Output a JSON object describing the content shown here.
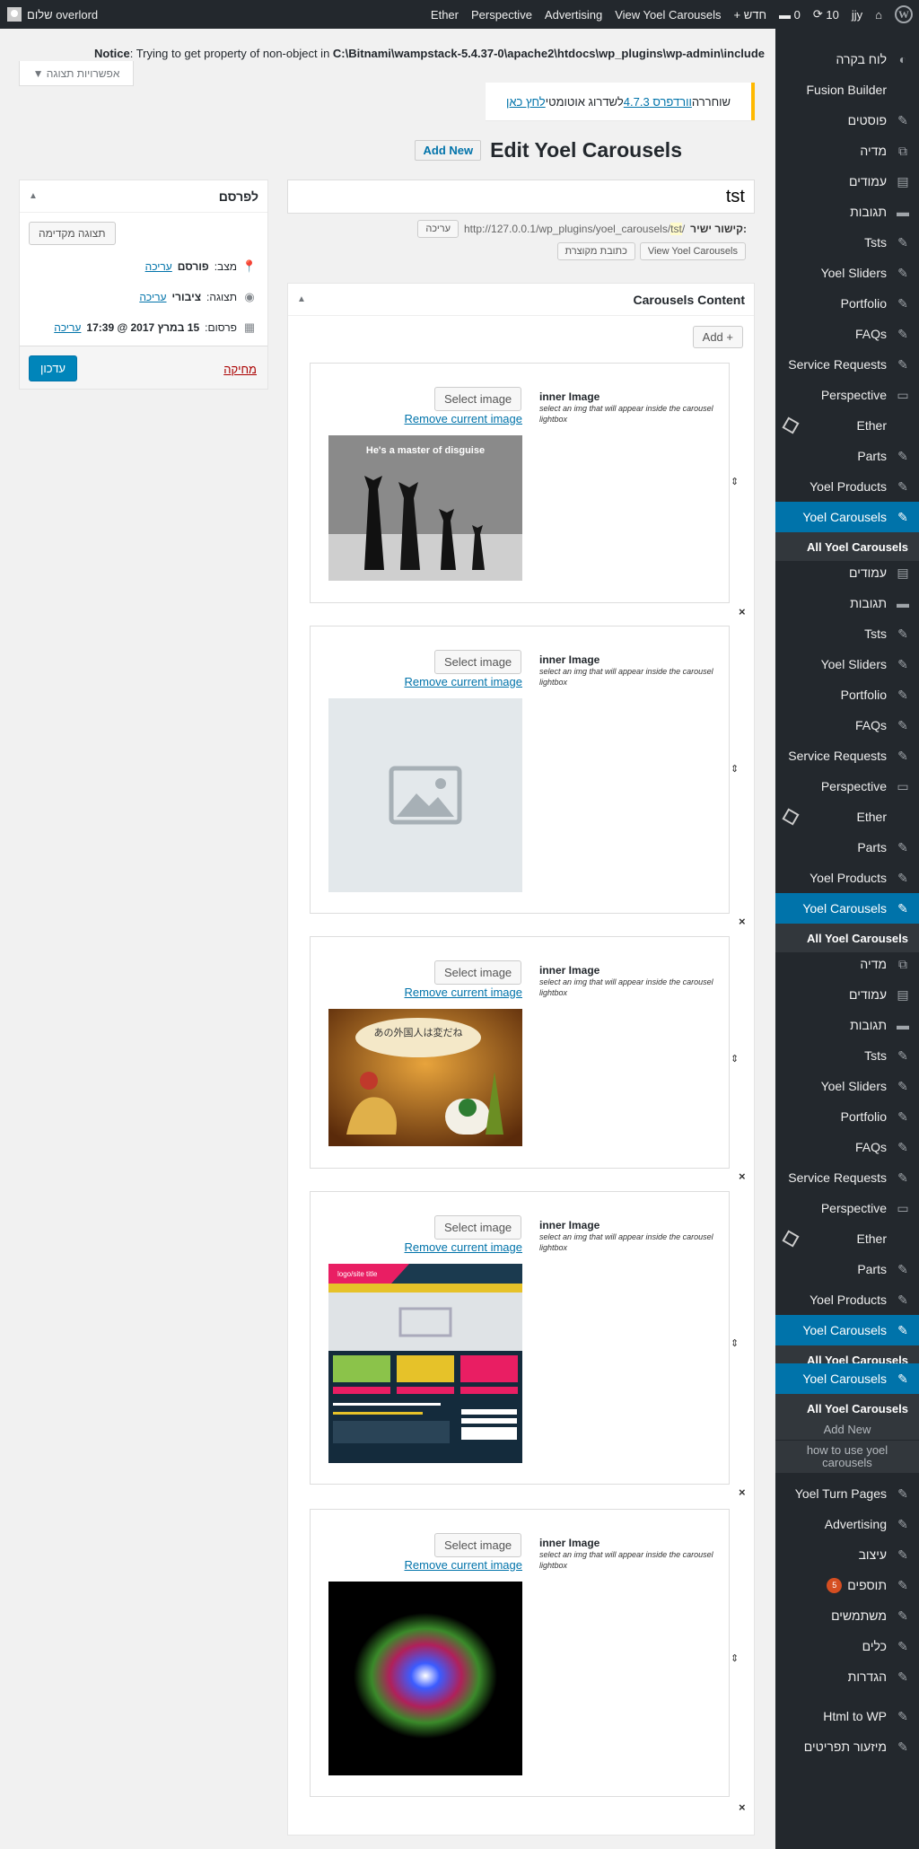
{
  "adminbar": {
    "user": "שלום overlord",
    "items": [
      "Ether",
      "Perspective",
      "Advertising",
      "View Yoel Carousels",
      "חדש",
      "0",
      "10",
      "jjy"
    ],
    "new_plus": "+"
  },
  "notice": {
    "label": "Notice",
    "text": ": Trying to get property of non-object in ",
    "path": "C:\\Bitnami\\wampstack-5.4.37-0\\apache2\\htdocs\\wp_plugins\\wp-admin\\include"
  },
  "screen_options": "אפשרויות תצוגה",
  "update_nag": {
    "pre": "שוחררה ",
    "link1": "וורדפרס 4.7.3",
    "mid": " לשדרוג אוטומטי ",
    "link2": "לחץ כאן"
  },
  "page": {
    "title": "Edit Yoel Carousels",
    "add_new": "Add New"
  },
  "post_title": "tst",
  "permalink": {
    "label": "קישור ישיר:",
    "url_pre": "http://127.0.0.1/wp_plugins/yoel_carousels/",
    "slug": "tst",
    "url_post": "/",
    "edit": "עריכה",
    "view_btn": "View Yoel Carousels",
    "shortlink_btn": "כתובת מקוצרת"
  },
  "content_box": {
    "title": "Carousels Content",
    "add": "Add +",
    "select_label": "Select image",
    "remove_label": "Remove current image",
    "inner_title": "inner Image",
    "inner_desc": "select an img that will appear inside the carousel lightbox",
    "thumb_captions": [
      "He's a master of disguise",
      "",
      "あの外国人は変だね",
      "logo/site title",
      ""
    ]
  },
  "publish": {
    "title": "לפרסם",
    "preview": "תצוגה מקדימה",
    "status_label": "מצב:",
    "status_value": "פורסם",
    "visibility_label": "תצוגה:",
    "visibility_value": "ציבורי",
    "date_label": "פרסום:",
    "date_value": "15 במרץ 2017 @ 17:39",
    "edit": "עריכה",
    "delete": "מחיקה",
    "update": "עדכון"
  },
  "sidebar": {
    "items": [
      "לוח בקרה",
      "Fusion Builder",
      "פוסטים",
      "מדיה",
      "עמודים",
      "תגובות",
      "Tsts",
      "Yoel Sliders",
      "Portfolio",
      "FAQs",
      "Service Requests",
      "Perspective",
      "Ether",
      "Parts",
      "Yoel Products",
      "Yoel Carousels"
    ],
    "sub_title": "All Yoel Carousels",
    "repeat2": [
      "עמודים",
      "תגובות",
      "Tsts",
      "Yoel Sliders",
      "Portfolio",
      "FAQs",
      "Service Requests",
      "Perspective",
      "Ether",
      "Parts",
      "Yoel Products",
      "Yoel Carousels"
    ],
    "repeat3": [
      "מדיה",
      "עמודים",
      "תגובות",
      "Tsts",
      "Yoel Sliders",
      "Portfolio",
      "FAQs",
      "Service Requests",
      "Perspective",
      "Ether",
      "Parts",
      "Yoel Products",
      "Yoel Carousels"
    ],
    "repeat4": "Yoel Carousels",
    "add_new": "Add New",
    "how_to": "how to use yoel carousels",
    "bottom": [
      "Yoel Turn Pages",
      "Advertising",
      "עיצוב",
      "תוספים",
      "משתמשים",
      "כלים",
      "הגדרות",
      "Html to WP",
      "מיזעור תפריטים"
    ],
    "plugins_badge": "5"
  }
}
